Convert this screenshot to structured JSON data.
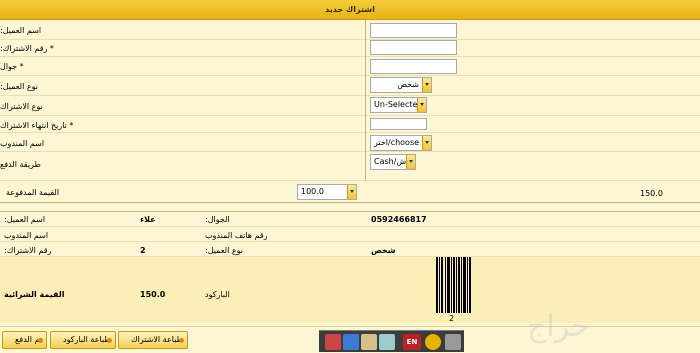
{
  "window": {
    "title": "اشتراك جديد"
  },
  "form": {
    "customer_name_label": "اسم العميل:",
    "subscription_number_label": "* رقم الاشتراك:",
    "mobile_label": "* جوال",
    "customer_type_label": "نوع العميل:",
    "customer_type_value": "شخص",
    "subscription_type_label": "نوع الاشتراك",
    "subscription_type_value": "Un-Selected",
    "expiry_label": "* تاريخ انتهاء الاشتراك",
    "rep_name_label": "اسم المندوب",
    "rep_name_value": "اختر/choose --",
    "payment_method_label": "طريقة الدفع",
    "payment_method_value": "Cash/كاش",
    "paid_value_label": "القيمة المدفوعة",
    "paid_value_input": "100.0",
    "paid_value_total": "150.0"
  },
  "summary": {
    "customer_name_label": "اسم العميل:",
    "customer_name_value": "علاء",
    "mobile_label": "الجوال:",
    "mobile_value": "0592466817",
    "rep_name_label": "اسم المندوب",
    "rep_phone_label": "رقم هاتف المندوب",
    "subscription_number_label": "رقم الاشتراك:",
    "subscription_number_value": "2",
    "customer_type_label": "نوع العميل:",
    "customer_type_value": "شخص",
    "purchase_value_label": "القيمة الشرائية",
    "purchase_value": "150.0",
    "barcode_label": "الباركود",
    "barcode_number": "2"
  },
  "buttons": {
    "print_subscription": "طباعة الاشتراك",
    "print_barcode": "طباعة الباركود",
    "payment_done": "تم الدفع"
  },
  "taskbar": {
    "lang_label": "EN"
  },
  "watermark": {
    "text": "حراج"
  }
}
